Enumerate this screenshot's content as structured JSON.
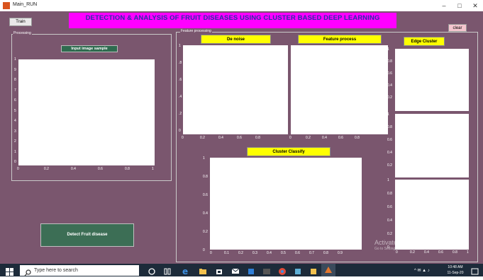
{
  "window": {
    "title": "Main_RUN",
    "minimize": "–",
    "maximize": "□",
    "close": "✕"
  },
  "toolbar": {
    "train_label": "Train",
    "clear_label": "clear"
  },
  "header": {
    "title": "DETECTION & ANALYSIS OF FRUIT DISEASES USING CLUSTER BASED DEEP LEARNING"
  },
  "processing_panel": {
    "title": "Processing",
    "input_label": "Input image sample",
    "detect_label": "Detect Fruit disease"
  },
  "feature_panel": {
    "title": "Feature processing",
    "denoise_label": "De noise",
    "feature_label": "Feature process",
    "edge_label": "Edge Cluster",
    "cluster_label": "Cluster Classify"
  },
  "watermark": {
    "line1": "Activate Windows",
    "line2": "Go to Settings to activate Windows."
  },
  "taskbar": {
    "search_placeholder": "Type here to search",
    "time": "10:48 AM",
    "date": "11-Sep-20"
  },
  "colors": {
    "background": "#7a566e",
    "banner": "#ff00ff",
    "label": "#ffff00",
    "detect_button": "#3c6e55"
  }
}
